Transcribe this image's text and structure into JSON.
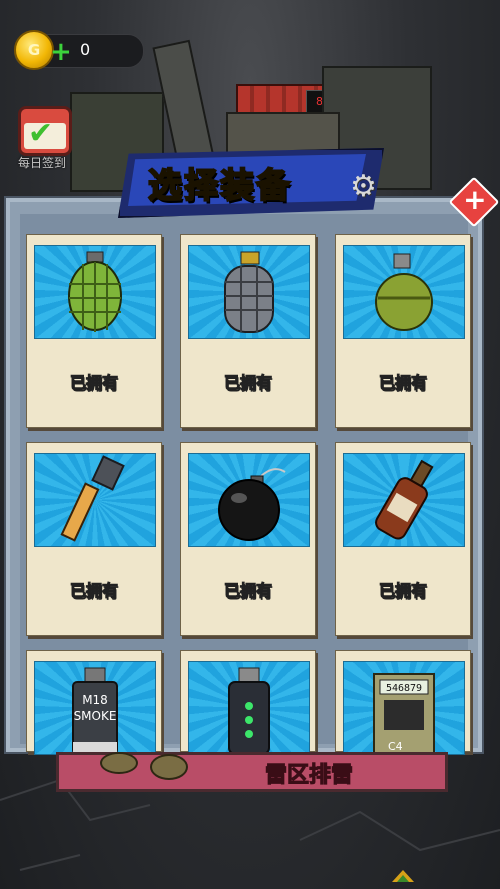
{
  "currency": {
    "coin_symbol": "G",
    "amount": "0",
    "add_symbol": "+"
  },
  "daily_checkin": {
    "label": "每日签到"
  },
  "title": "选择装备",
  "close_symbol": "+",
  "items": [
    {
      "name": "frag-grenade-green",
      "status": "已拥有"
    },
    {
      "name": "frag-grenade-gray",
      "status": "已拥有"
    },
    {
      "name": "round-grenade-olive",
      "status": "已拥有"
    },
    {
      "name": "stick-grenade",
      "status": "已拥有"
    },
    {
      "name": "black-bomb",
      "status": "已拥有"
    },
    {
      "name": "molotov-bottle",
      "status": "已拥有"
    },
    {
      "name": "smoke-grenade",
      "status": ""
    },
    {
      "name": "flash-grenade",
      "status": ""
    },
    {
      "name": "c4-explosive",
      "status": ""
    }
  ],
  "smoke_label": {
    "line1": "M18",
    "line2": "SMOKE"
  },
  "c4": {
    "display": "546879",
    "tag": "C4"
  },
  "bottom_button": {
    "label": "雷区排雷"
  },
  "colors": {
    "accent_title": "#ffe23a",
    "banner": "#2a47b8",
    "card_bg": "#efe6cb",
    "close": "#e7423f"
  }
}
